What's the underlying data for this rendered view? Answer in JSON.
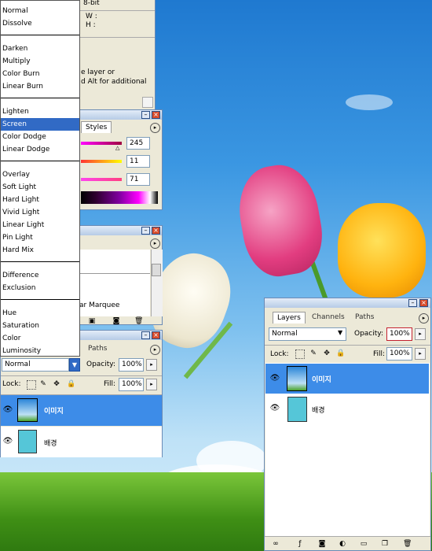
{
  "colors": {
    "accent": "#316ac5",
    "panel_bg": "#ece9d8",
    "layer_swatch": "#55c6d8"
  },
  "blend_modes": {
    "groups": [
      [
        "Normal",
        "Dissolve"
      ],
      [
        "Darken",
        "Multiply",
        "Color Burn",
        "Linear Burn"
      ],
      [
        "Lighten",
        "Screen",
        "Color Dodge",
        "Linear Dodge"
      ],
      [
        "Overlay",
        "Soft Light",
        "Hard Light",
        "Vivid Light",
        "Linear Light",
        "Pin Light",
        "Hard Mix"
      ],
      [
        "Difference",
        "Exclusion"
      ],
      [
        "Hue",
        "Saturation",
        "Color",
        "Luminosity"
      ]
    ],
    "selected": "Screen"
  },
  "info_panel": {
    "mode_text": "8-bit",
    "w_label": "W :",
    "h_label": "H :",
    "hint_line1": "e layer or",
    "hint_line2": "d Alt for additional"
  },
  "color_panel": {
    "tab": "Styles",
    "values": [
      "245",
      "11",
      "71"
    ]
  },
  "history_panel": {
    "item": "ar Marquee"
  },
  "left_layers": {
    "tab_paths": "Paths",
    "blend_value": "Normal",
    "opacity_label": "Opacity:",
    "opacity_value": "100%",
    "lock_label": "Lock:",
    "fill_label": "Fill:",
    "fill_value": "100%",
    "layers": [
      {
        "name": "이미지",
        "selected": true,
        "type": "image"
      },
      {
        "name": "배경",
        "selected": false,
        "type": "swatch"
      }
    ]
  },
  "right_layers": {
    "tabs": [
      "Layers",
      "Channels",
      "Paths"
    ],
    "blend_value": "Normal",
    "opacity_label": "Opacity:",
    "opacity_value": "100%",
    "lock_label": "Lock:",
    "fill_label": "Fill:",
    "fill_value": "100%",
    "layers": [
      {
        "name": "이미지",
        "selected": true,
        "type": "image"
      },
      {
        "name": "배경",
        "selected": false,
        "type": "swatch"
      }
    ]
  },
  "icons": [
    "eye-icon",
    "link-icon",
    "fx-icon",
    "mask-icon",
    "adjustment-icon",
    "folder-icon",
    "new-layer-icon",
    "trash-icon",
    "lock-icon",
    "brush-icon",
    "move-icon",
    "close-icon",
    "minimize-icon",
    "menu-arrow-icon",
    "dropdown-arrow-icon"
  ]
}
